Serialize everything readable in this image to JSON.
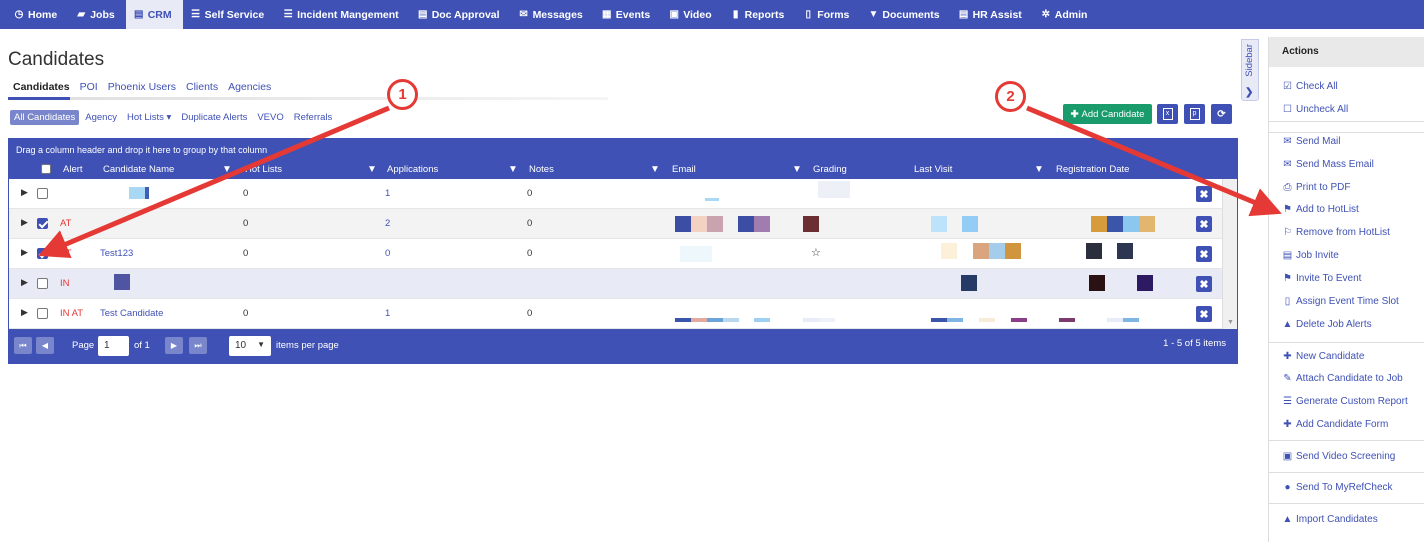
{
  "nav": {
    "items": [
      {
        "label": "Home",
        "icon": "clock-icon",
        "glyph": "◷",
        "key": "home",
        "active": false
      },
      {
        "label": "Jobs",
        "icon": "folder-icon",
        "glyph": "▰",
        "key": "jobs",
        "active": false
      },
      {
        "label": "CRM",
        "icon": "briefcase-icon",
        "glyph": "▤",
        "key": "crm",
        "active": true
      },
      {
        "label": "Self Service",
        "icon": "list-icon",
        "glyph": "☰",
        "key": "self-service",
        "active": false
      },
      {
        "label": "Incident Mangement",
        "icon": "list-icon",
        "glyph": "☰",
        "key": "incident-management",
        "active": false
      },
      {
        "label": "Doc Approval",
        "icon": "document-icon",
        "glyph": "▤",
        "key": "doc-approval",
        "active": false
      },
      {
        "label": "Messages",
        "icon": "envelope-icon",
        "glyph": "✉",
        "key": "messages",
        "active": false
      },
      {
        "label": "Events",
        "icon": "calendar-icon",
        "glyph": "▦",
        "key": "events",
        "active": false
      },
      {
        "label": "Video",
        "icon": "video-icon",
        "glyph": "▣",
        "key": "video",
        "active": false
      },
      {
        "label": "Reports",
        "icon": "book-icon",
        "glyph": "▮",
        "key": "reports",
        "active": false
      },
      {
        "label": "Forms",
        "icon": "file-icon",
        "glyph": "▯",
        "key": "forms",
        "active": false
      },
      {
        "label": "Documents",
        "icon": "filter-icon",
        "glyph": "▼",
        "key": "documents",
        "active": false
      },
      {
        "label": "HR Assist",
        "icon": "briefcase-icon",
        "glyph": "▤",
        "key": "hr-assist",
        "active": false
      },
      {
        "label": "Admin",
        "icon": "gear-icon",
        "glyph": "✲",
        "key": "admin",
        "active": false
      }
    ]
  },
  "page": {
    "title": "Candidates"
  },
  "subtabs": [
    "Candidates",
    "POI",
    "Phoenix Users",
    "Clients",
    "Agencies"
  ],
  "filters": [
    "All Candidates",
    "Agency",
    "Hot Lists ▾",
    "Duplicate Alerts",
    "VEVO",
    "Referrals"
  ],
  "toolbar": {
    "add_candidate": "Add Candidate"
  },
  "sidebar_tab": {
    "label": "Sidebar"
  },
  "grid": {
    "group_hint": "Drag a column header and drop it here to group by that column",
    "columns": [
      "Alert",
      "Candidate Name",
      "Hot Lists",
      "Applications",
      "Notes",
      "Email",
      "Grading",
      "Last Visit",
      "Registration Date"
    ],
    "rows": [
      {
        "checked": false,
        "alert": "",
        "name": "",
        "hot_lists": "0",
        "applications": "1",
        "notes": "0",
        "grading": ""
      },
      {
        "checked": true,
        "alert": "AT",
        "name": "",
        "hot_lists": "0",
        "applications": "2",
        "notes": "0",
        "grading": ""
      },
      {
        "checked": true,
        "alert": "AT",
        "name": "Test123",
        "hot_lists": "0",
        "applications": "0",
        "notes": "0",
        "grading": "☆"
      },
      {
        "checked": false,
        "alert": "IN",
        "name": "",
        "hot_lists": "",
        "applications": "",
        "notes": "",
        "grading": ""
      },
      {
        "checked": false,
        "alert": "IN AT",
        "name": "Test Candidate",
        "hot_lists": "0",
        "applications": "1",
        "notes": "0",
        "grading": ""
      }
    ]
  },
  "pager": {
    "page_label": "Page",
    "page_value": "1",
    "of_label": "of 1",
    "per_page_value": "10",
    "per_page_label": "items per page",
    "summary": "1 - 5 of 5 items"
  },
  "actions": {
    "title": "Actions",
    "items": [
      {
        "label": "Check All",
        "icon": "check-square-icon",
        "glyph": "☑"
      },
      {
        "label": "Uncheck All",
        "icon": "square-icon",
        "glyph": "☐"
      },
      {
        "label": "Send Mail",
        "icon": "envelope-icon",
        "glyph": "✉"
      },
      {
        "label": "Send Mass Email",
        "icon": "envelope-icon",
        "glyph": "✉"
      },
      {
        "label": "Print to PDF",
        "icon": "printer-icon",
        "glyph": "⎙"
      },
      {
        "label": "Add to HotList",
        "icon": "flag-icon",
        "glyph": "⚑"
      },
      {
        "label": "Remove from HotList",
        "icon": "flag-outline-icon",
        "glyph": "⚐"
      },
      {
        "label": "Job Invite",
        "icon": "briefcase-icon",
        "glyph": "▤"
      },
      {
        "label": "Invite To Event",
        "icon": "flag-icon",
        "glyph": "⚑"
      },
      {
        "label": "Assign Event Time Slot",
        "icon": "mobile-icon",
        "glyph": "▯"
      },
      {
        "label": "Delete Job Alerts",
        "icon": "warning-icon",
        "glyph": "▲"
      },
      {
        "label": "New Candidate",
        "icon": "plus-icon",
        "glyph": "✚"
      },
      {
        "label": "Attach Candidate to Job",
        "icon": "paperclip-icon",
        "glyph": "✎"
      },
      {
        "label": "Generate Custom Report",
        "icon": "list-icon",
        "glyph": "☰"
      },
      {
        "label": "Add Candidate Form",
        "icon": "plus-icon",
        "glyph": "✚"
      },
      {
        "label": "Send Video Screening",
        "icon": "video-icon",
        "glyph": "▣"
      },
      {
        "label": "Send To MyRefCheck",
        "icon": "apple-icon",
        "glyph": "●"
      },
      {
        "label": "Import Candidates",
        "icon": "user-import-icon",
        "glyph": "▲"
      }
    ]
  },
  "annotations": {
    "callout_1": "1",
    "callout_2": "2"
  },
  "colors": {
    "primary": "#3f51b5",
    "success": "#1a9b6c",
    "alert": "#e53935",
    "annotation": "#e53935"
  }
}
